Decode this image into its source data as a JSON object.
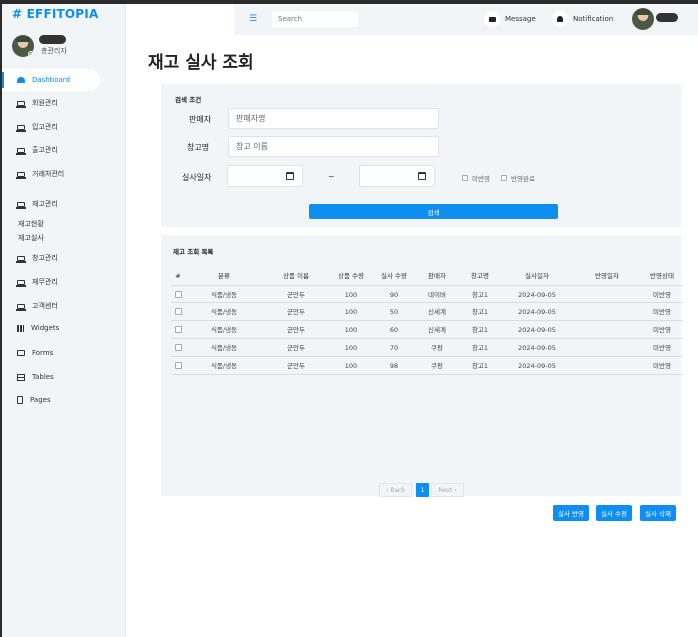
{
  "brand": {
    "hash": "#",
    "name": "EFFITOPIA"
  },
  "user": {
    "role": "총관리자"
  },
  "sidebar": {
    "items": [
      {
        "label": "Dashboard",
        "icon": "dashboard-icon"
      },
      {
        "label": "회원관리",
        "icon": "laptop-icon"
      },
      {
        "label": "입고관리",
        "icon": "laptop-icon"
      },
      {
        "label": "출고관리",
        "icon": "laptop-icon"
      },
      {
        "label": "거래처관리",
        "icon": "laptop-icon"
      },
      {
        "label": "재고관리",
        "icon": "laptop-icon"
      },
      {
        "label": "창고관리",
        "icon": "laptop-icon"
      },
      {
        "label": "재무관리",
        "icon": "laptop-icon"
      },
      {
        "label": "고객센터",
        "icon": "laptop-icon"
      },
      {
        "label": "Widgets",
        "icon": "grid-icon"
      },
      {
        "label": "Forms",
        "icon": "form-icon"
      },
      {
        "label": "Tables",
        "icon": "table-icon"
      },
      {
        "label": "Pages",
        "icon": "page-icon"
      }
    ],
    "sub_items": [
      "재고현황",
      "재고실사"
    ]
  },
  "topbar": {
    "search_placeholder": "Search",
    "message_label": "Message",
    "notification_label": "Notification"
  },
  "page": {
    "title": "재고 실사 조회"
  },
  "search_panel": {
    "title": "검색 조건",
    "seller_label": "판매자",
    "seller_placeholder": "판매자명",
    "warehouse_label": "창고명",
    "warehouse_placeholder": "창고 이름",
    "date_label": "실사일자",
    "tilde": "~",
    "unapplied_label": "미반영",
    "applied_label": "반영완료",
    "search_button": "검색"
  },
  "list_panel": {
    "title": "재고 조회 목록",
    "columns": [
      "#",
      "분류",
      "상품 이름",
      "상품 수량",
      "실사 수량",
      "판매자",
      "창고명",
      "실사일자",
      "반영일자",
      "반영상태"
    ],
    "rows": [
      {
        "category": "식품/냉동",
        "product": "군만두",
        "qty": "100",
        "actual": "90",
        "seller": "네이버",
        "warehouse": "창고1",
        "date": "2024-09-05",
        "applied_date": "",
        "status": "미반영"
      },
      {
        "category": "식품/냉동",
        "product": "군만두",
        "qty": "100",
        "actual": "50",
        "seller": "신세계",
        "warehouse": "창고1",
        "date": "2024-09-05",
        "applied_date": "",
        "status": "미반영"
      },
      {
        "category": "식품/냉동",
        "product": "군만두",
        "qty": "100",
        "actual": "60",
        "seller": "신세계",
        "warehouse": "창고1",
        "date": "2024-09-05",
        "applied_date": "",
        "status": "미반영"
      },
      {
        "category": "식품/냉동",
        "product": "군만두",
        "qty": "100",
        "actual": "70",
        "seller": "쿠팡",
        "warehouse": "창고1",
        "date": "2024-09-05",
        "applied_date": "",
        "status": "미반영"
      },
      {
        "category": "식품/냉동",
        "product": "군만두",
        "qty": "100",
        "actual": "98",
        "seller": "쿠팡",
        "warehouse": "창고1",
        "date": "2024-09-05",
        "applied_date": "",
        "status": "미반영"
      }
    ],
    "pager": {
      "prev": "‹ Back",
      "current": "1",
      "next": "Next ›"
    }
  },
  "actions": {
    "apply": "실사 반영",
    "edit": "실사 수정",
    "delete": "실사 삭제"
  },
  "colors": {
    "accent": "#0d8ef0",
    "panel": "#f2f5f8"
  }
}
